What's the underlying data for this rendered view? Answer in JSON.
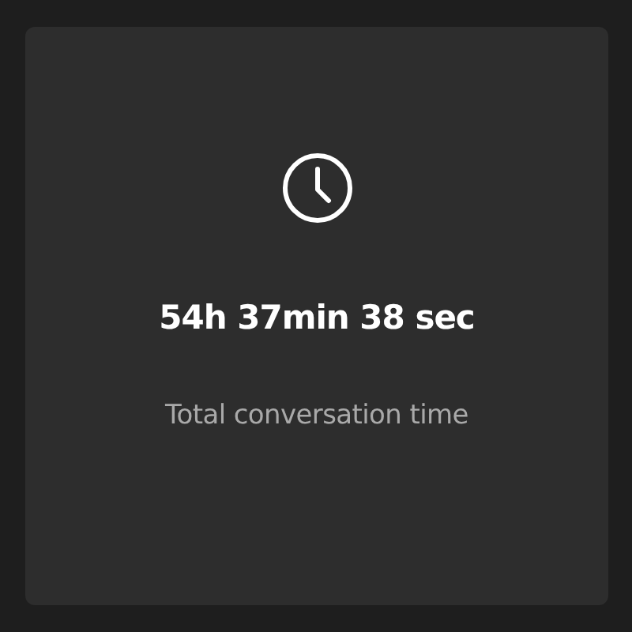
{
  "stat_card": {
    "value": "54h 37min 38 sec",
    "label": "Total conversation time"
  }
}
